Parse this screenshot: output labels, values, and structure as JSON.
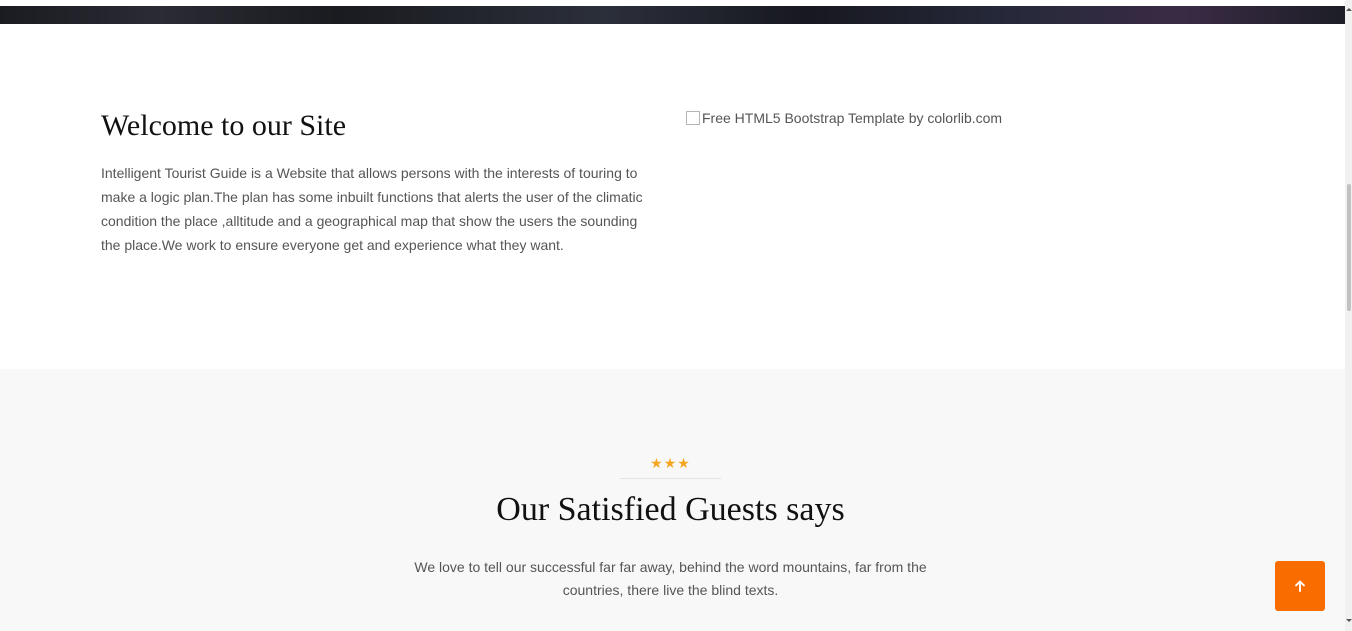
{
  "welcome": {
    "title": "Welcome to our Site",
    "text": "Intelligent Tourist Guide is a Website that allows persons with the interests of touring to make a logic plan.The plan has some inbuilt functions that alerts the user of the climatic condition the place ,alltitude and a geographical map that show the users the sounding the place.We work to ensure everyone get and experience what they want.",
    "image_alt": "Free HTML5 Bootstrap Template by colorlib.com"
  },
  "testimonials": {
    "stars": "★★★",
    "title": "Our Satisfied Guests says",
    "text": "We love to tell our successful far far away, behind the word mountains, far from the countries, there live the blind texts."
  },
  "back_to_top": {
    "icon": "arrow-up-icon"
  },
  "colors": {
    "accent_orange": "#f96d00",
    "star_color": "#f5a623",
    "body_text": "#555555",
    "section_bg": "#f8f8f8"
  }
}
